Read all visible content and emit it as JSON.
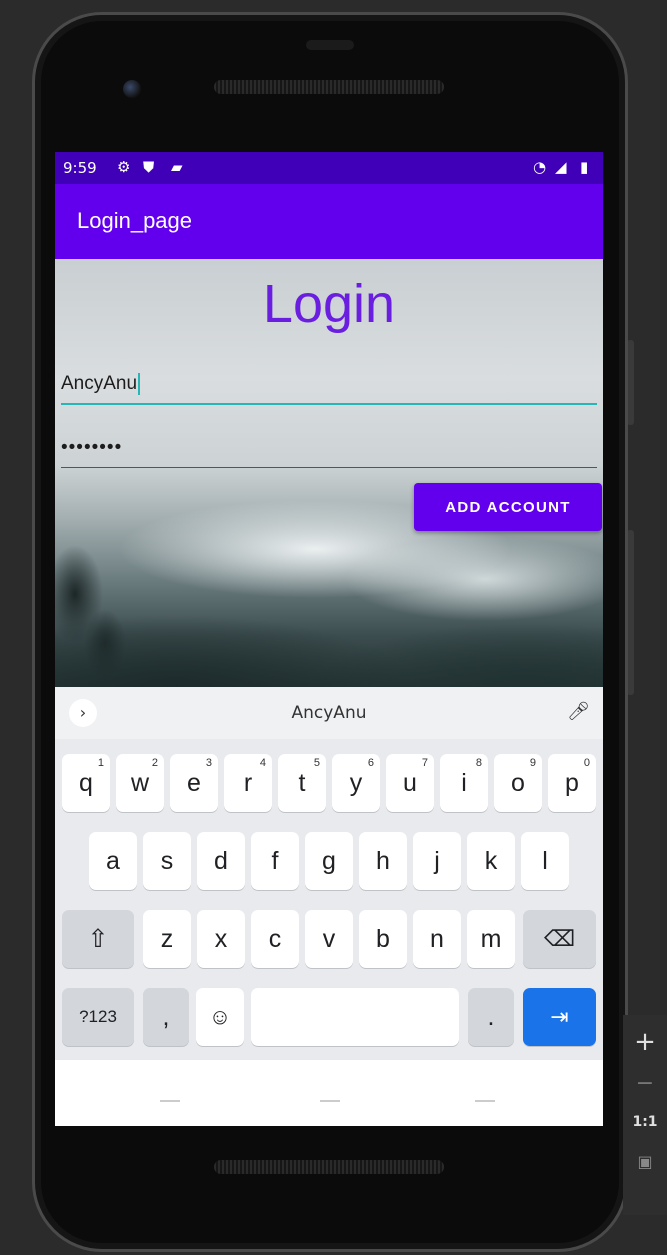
{
  "status_bar": {
    "time": "9:59",
    "left_icons": [
      "settings-icon",
      "shield-icon",
      "sd-card-icon"
    ],
    "right_icons": [
      "wifi-icon",
      "signal-icon",
      "battery-icon"
    ],
    "color": "#3f00b8"
  },
  "app_bar": {
    "title": "Login_page",
    "color": "#6200ee"
  },
  "form": {
    "heading": "Login",
    "username_value": "AncyAnu",
    "password_mask": "••••••••",
    "add_account_label": "ADD ACCOUNT"
  },
  "keyboard": {
    "suggestion": "AncyAnu",
    "row1": [
      {
        "key": "q",
        "hint": "1"
      },
      {
        "key": "w",
        "hint": "2"
      },
      {
        "key": "e",
        "hint": "3"
      },
      {
        "key": "r",
        "hint": "4"
      },
      {
        "key": "t",
        "hint": "5"
      },
      {
        "key": "y",
        "hint": "6"
      },
      {
        "key": "u",
        "hint": "7"
      },
      {
        "key": "i",
        "hint": "8"
      },
      {
        "key": "o",
        "hint": "9"
      },
      {
        "key": "p",
        "hint": "0"
      }
    ],
    "row2": [
      "a",
      "s",
      "d",
      "f",
      "g",
      "h",
      "j",
      "k",
      "l"
    ],
    "row3": [
      "z",
      "x",
      "c",
      "v",
      "b",
      "n",
      "m"
    ],
    "symbols_label": "?123",
    "comma": ",",
    "period": ".",
    "action_color": "#1a73e8"
  },
  "emulator_tools": {
    "zoom_in": "+",
    "zoom_out": "−",
    "actual_size": "1:1"
  }
}
